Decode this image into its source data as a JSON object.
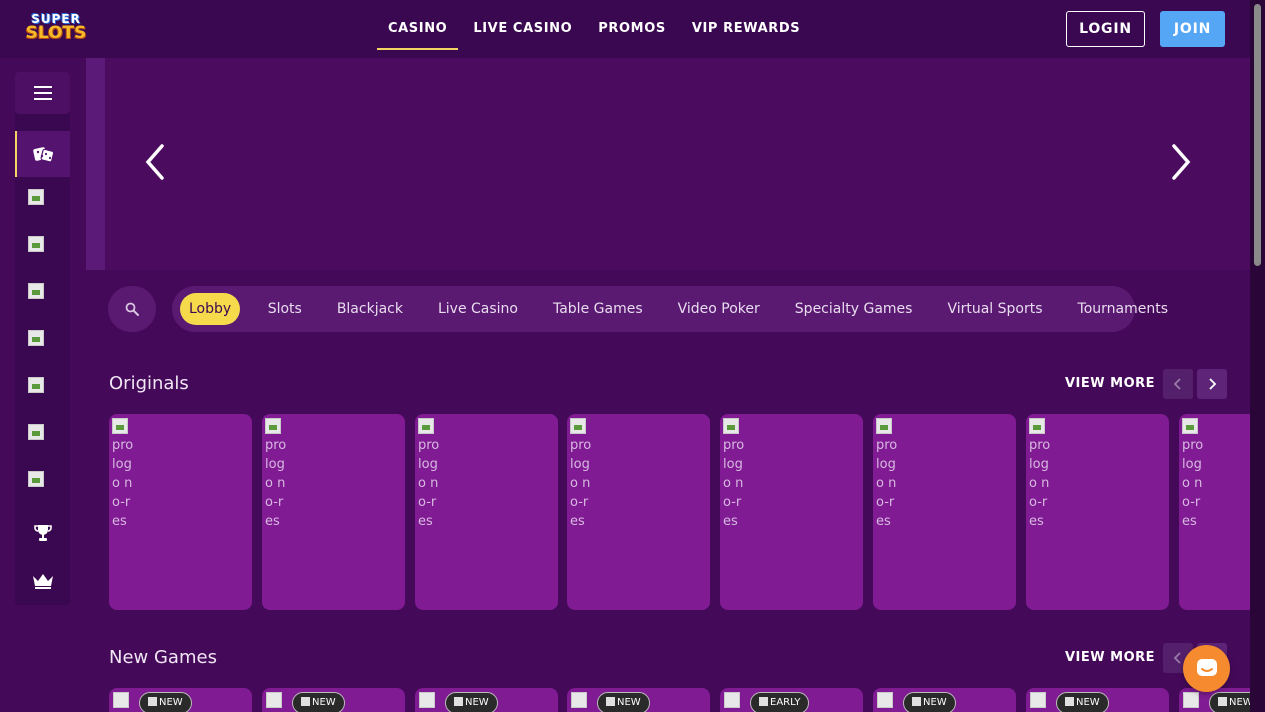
{
  "brand": {
    "logo_line1": "SUPER",
    "logo_line2": "SLOTS"
  },
  "nav": {
    "items": [
      {
        "label": "CASINO",
        "active": true
      },
      {
        "label": "LIVE CASINO",
        "active": false
      },
      {
        "label": "PROMOS",
        "active": false
      },
      {
        "label": "VIP REWARDS",
        "active": false
      }
    ]
  },
  "auth": {
    "login_label": "LOGIN",
    "join_label": "JOIN"
  },
  "sidebar": {
    "items": [
      {
        "icon": "menu-icon"
      },
      {
        "icon": "dice-icon",
        "active": true
      },
      {
        "icon": "broken-image-icon"
      },
      {
        "icon": "broken-image-icon"
      },
      {
        "icon": "broken-image-icon"
      },
      {
        "icon": "broken-image-icon"
      },
      {
        "icon": "broken-image-icon"
      },
      {
        "icon": "broken-image-icon"
      },
      {
        "icon": "broken-image-icon"
      },
      {
        "icon": "trophy-icon"
      },
      {
        "icon": "crown-icon"
      }
    ]
  },
  "categories": [
    {
      "label": "Lobby",
      "active": true
    },
    {
      "label": "Slots"
    },
    {
      "label": "Blackjack"
    },
    {
      "label": "Live Casino"
    },
    {
      "label": "Table Games"
    },
    {
      "label": "Video Poker"
    },
    {
      "label": "Specialty Games"
    },
    {
      "label": "Virtual Sports"
    },
    {
      "label": "Tournaments"
    }
  ],
  "originals": {
    "title": "Originals",
    "view_more": "VIEW MORE",
    "card_alt": "pro logo no-res",
    "card_count": 8
  },
  "new_games": {
    "title": "New Games",
    "view_more": "VIEW MORE",
    "badges": [
      "NEW",
      "NEW",
      "NEW",
      "NEW",
      "EARLY",
      "NEW",
      "NEW",
      "NEW"
    ]
  },
  "colors": {
    "background": "#45095a",
    "card": "#801b93",
    "accent_yellow": "#f7d94c",
    "join_blue": "#55a6f5",
    "chat_orange": "#f58a2e"
  }
}
